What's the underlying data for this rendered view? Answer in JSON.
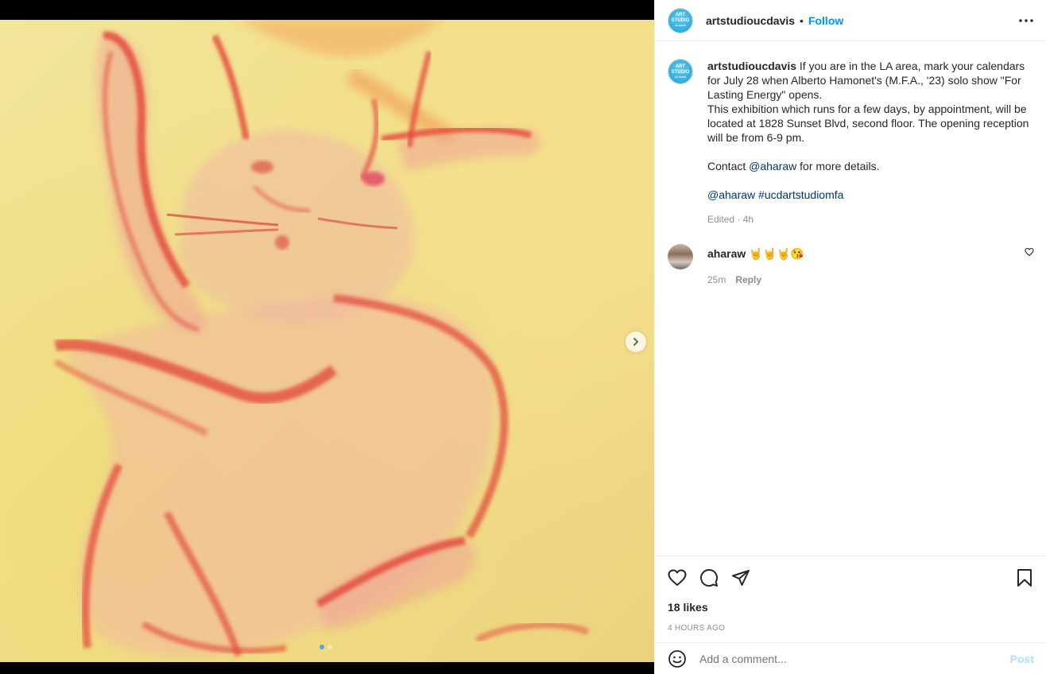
{
  "media": {
    "artwork_icon": "painting-of-cat",
    "next_icon": "chevron-right-icon",
    "carousel": {
      "count": 2,
      "active_index": 0
    }
  },
  "header": {
    "username": "artstudioucdavis",
    "separator": "•",
    "follow_label": "Follow",
    "more_icon": "more-horizontal-icon",
    "logo_lines": [
      "ART",
      "STUDIO",
      "UC DAVIS"
    ]
  },
  "caption": {
    "username": "artstudioucdavis",
    "text_line1": " If you are in the LA area, mark your calendars for July 28 when Alberto Hamonet's (M.F.A., '23) solo show \"For Lasting Energy\" opens.",
    "text_line2": "This exhibition which runs for a few days, by appointment, will be located at 1828 Sunset Blvd, second floor. The opening reception will be from 6-9 pm.",
    "contact_prefix": "Contact ",
    "contact_mention": "@aharaw",
    "contact_suffix": " for more details.",
    "tag_mention": "@aharaw",
    "hashtag": "#ucdartstudiomfa",
    "meta": "Edited · 4h"
  },
  "comments": [
    {
      "username": "aharaw",
      "text": " 🤘🤘🤘😘",
      "time": "25m",
      "reply_label": "Reply",
      "like_icon": "heart-outline-icon"
    }
  ],
  "actions": {
    "like_icon": "heart-outline-icon",
    "comment_icon": "comment-bubble-icon",
    "share_icon": "paper-plane-icon",
    "save_icon": "bookmark-icon"
  },
  "likes": "18 likes",
  "timestamp": "4 HOURS AGO",
  "add_comment": {
    "emoji_icon": "smiley-icon",
    "placeholder": "Add a comment...",
    "post_label": "Post"
  },
  "colors": {
    "accent": "#0095f6",
    "post_disabled": "#b2dffc",
    "link": "#00376b",
    "muted": "#8e8e8e",
    "text": "#262626",
    "artwork_bg": "#f0df8c",
    "artwork_paint": "#e2443a"
  }
}
